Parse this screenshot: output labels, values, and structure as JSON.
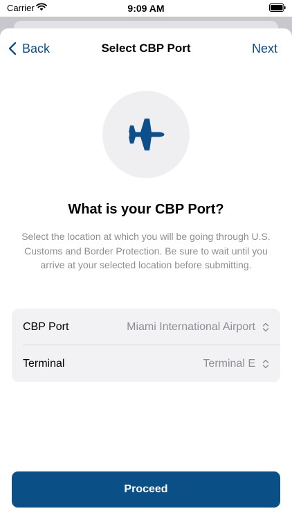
{
  "status_bar": {
    "carrier": "Carrier",
    "time": "9:09 AM"
  },
  "nav": {
    "back_label": "Back",
    "title": "Select CBP Port",
    "next_label": "Next"
  },
  "hero": {
    "icon": "airplane-icon"
  },
  "content": {
    "heading": "What is your CBP Port?",
    "description": "Select the location at which you will be going through U.S. Customs and Border Protection. Be sure to wait until you arrive at your selected location before submitting."
  },
  "form": {
    "rows": [
      {
        "label": "CBP Port",
        "value": "Miami International Airport"
      },
      {
        "label": "Terminal",
        "value": "Terminal E"
      }
    ]
  },
  "actions": {
    "proceed_label": "Proceed"
  },
  "colors": {
    "accent": "#0d4f8b",
    "button": "#0b4f87",
    "secondary_text": "#8e8e93",
    "group_background": "#f2f2f5"
  }
}
